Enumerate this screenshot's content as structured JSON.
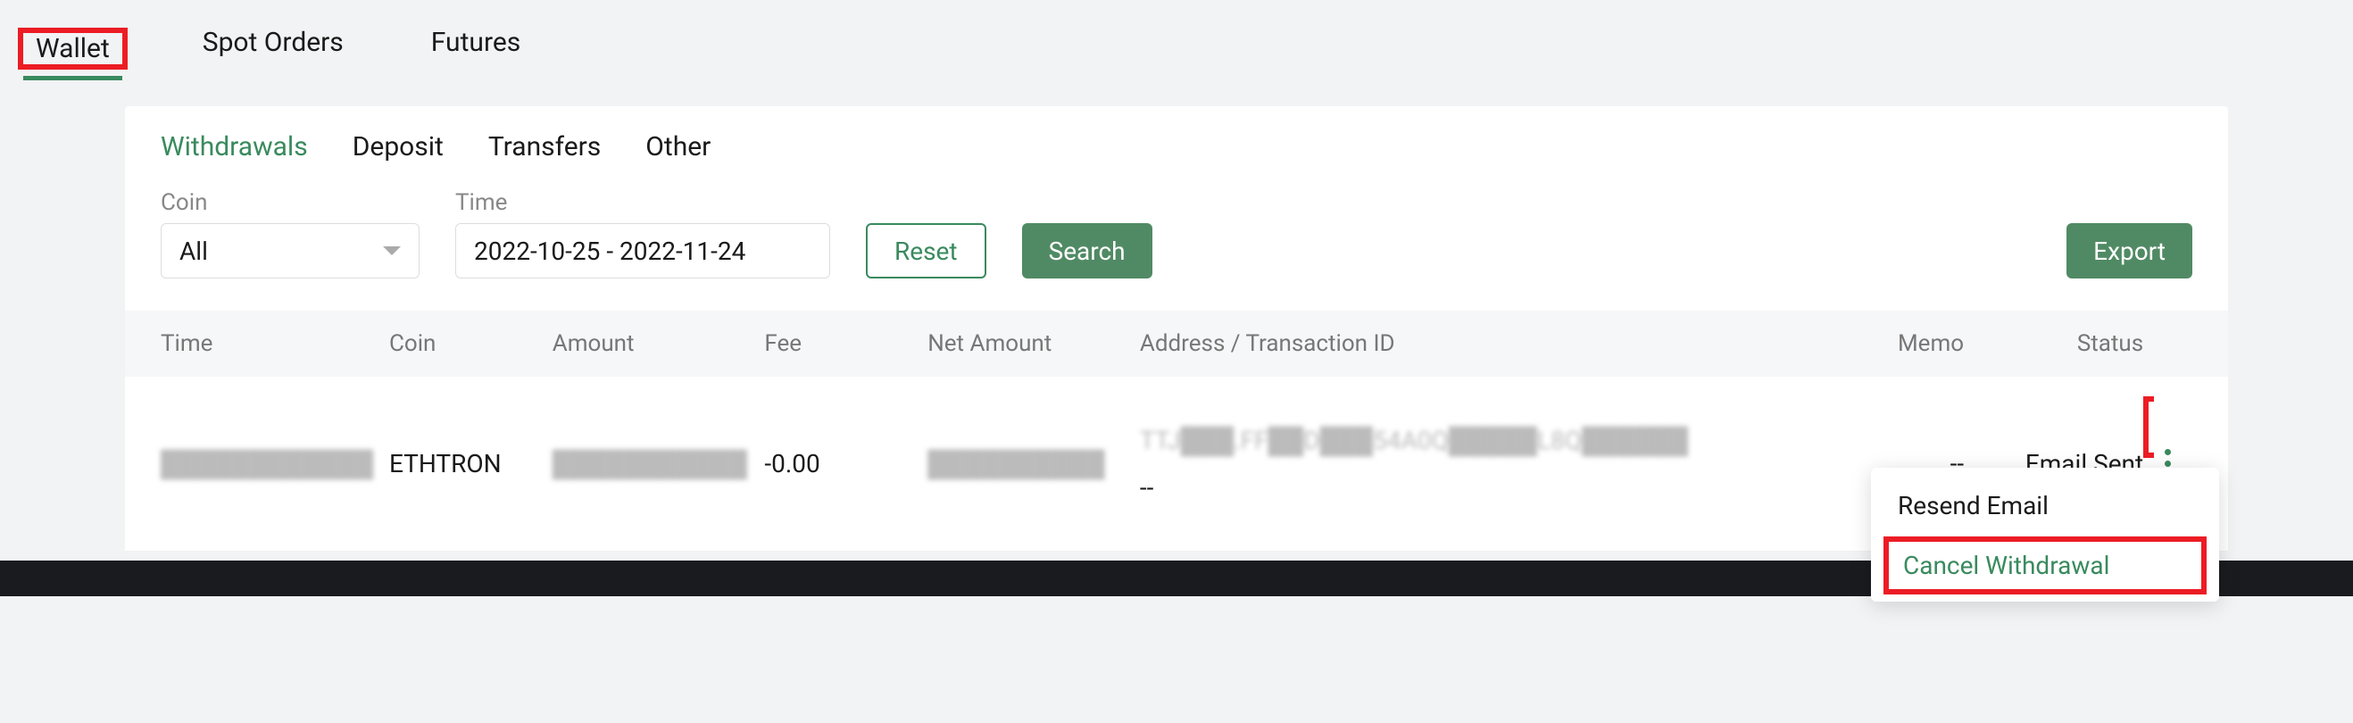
{
  "top_tabs": {
    "wallet": "Wallet",
    "spot_orders": "Spot Orders",
    "futures": "Futures"
  },
  "sub_tabs": {
    "withdrawals": "Withdrawals",
    "deposit": "Deposit",
    "transfers": "Transfers",
    "other": "Other"
  },
  "filters": {
    "coin_label": "Coin",
    "coin_value": "All",
    "time_label": "Time",
    "date_range": "2022-10-25 - 2022-11-24"
  },
  "buttons": {
    "reset": "Reset",
    "search": "Search",
    "export": "Export"
  },
  "table": {
    "headers": {
      "time": "Time",
      "coin": "Coin",
      "amount": "Amount",
      "fee": "Fee",
      "net_amount": "Net Amount",
      "address": "Address / Transaction ID",
      "memo": "Memo",
      "status": "Status"
    },
    "row": {
      "time": "████████████",
      "coin": "ETHTRON",
      "amount": "███████████",
      "fee": "-0.00",
      "net_amount": "██████████",
      "address_line1": "TTJ███.FF██D███54A0Q█████L8Q██████",
      "address_line2": "--",
      "memo": "--",
      "status": "Email Sent"
    }
  },
  "dropdown": {
    "resend_email": "Resend Email",
    "cancel_withdrawal": "Cancel Withdrawal"
  }
}
